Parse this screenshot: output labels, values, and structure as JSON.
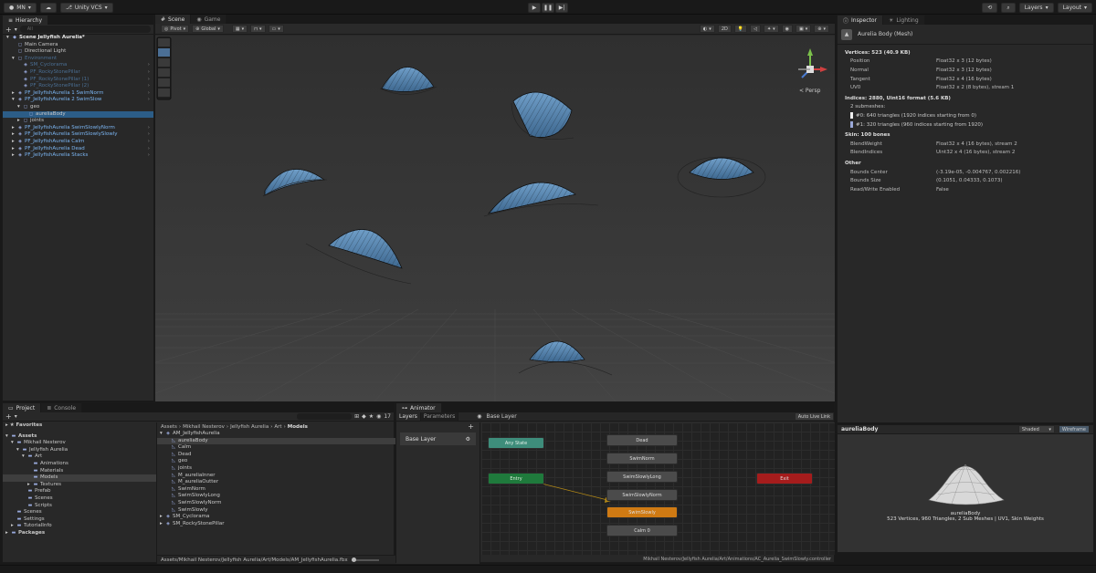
{
  "topbar": {
    "account": "MN",
    "vcs": "Unity VCS",
    "layers": "Layers",
    "layout": "Layout"
  },
  "hierarchy": {
    "tab": "Hierarchy",
    "search_placeholder": "All",
    "items": [
      {
        "label": "Scene Jellyfish Aurelia*",
        "level": 0,
        "style": "scene",
        "arrow": "▾",
        "icon": "unity-scene-icon"
      },
      {
        "label": "Main Camera",
        "level": 1,
        "style": "normal",
        "arrow": "",
        "icon": "gameobject-icon"
      },
      {
        "label": "Directional Light",
        "level": 1,
        "style": "normal",
        "arrow": "",
        "icon": "gameobject-icon"
      },
      {
        "label": "Environment",
        "level": 1,
        "style": "disabled",
        "arrow": "▾",
        "icon": "gameobject-icon"
      },
      {
        "label": "SM_Cyclorama",
        "level": 2,
        "style": "disabled",
        "arrow": "",
        "icon": "prefab-icon"
      },
      {
        "label": "PF_RockyStonePillar",
        "level": 2,
        "style": "disabled",
        "arrow": "",
        "icon": "prefab-icon"
      },
      {
        "label": "PF_RockyStonePillar (1)",
        "level": 2,
        "style": "disabled",
        "arrow": "",
        "icon": "prefab-icon"
      },
      {
        "label": "PF_RockyStonePillar (2)",
        "level": 2,
        "style": "disabled",
        "arrow": "",
        "icon": "prefab-icon"
      },
      {
        "label": "PF_JellyfishAurelia 1 SwimNorm",
        "level": 1,
        "style": "prefab",
        "arrow": "▸",
        "icon": "prefab-icon"
      },
      {
        "label": "PF_JellyfishAurelia 2 SwimSlow",
        "level": 1,
        "style": "prefab",
        "arrow": "▾",
        "icon": "prefab-icon"
      },
      {
        "label": "geo",
        "level": 2,
        "style": "normal",
        "arrow": "▾",
        "icon": "gameobject-icon"
      },
      {
        "label": "aureliaBody",
        "level": 3,
        "style": "normal",
        "arrow": "",
        "icon": "gameobject-icon"
      },
      {
        "label": "joints",
        "level": 2,
        "style": "normal",
        "arrow": "▸",
        "icon": "gameobject-icon"
      },
      {
        "label": "PF_JellyfishAurelia SwimSlowlyNorm",
        "level": 1,
        "style": "prefab",
        "arrow": "▸",
        "icon": "prefab-icon"
      },
      {
        "label": "PF_JellyfishAurelia SwimSlowlySlowly",
        "level": 1,
        "style": "prefab",
        "arrow": "▸",
        "icon": "prefab-icon"
      },
      {
        "label": "PF_JellyfishAurelia Calm",
        "level": 1,
        "style": "prefab",
        "arrow": "▸",
        "icon": "prefab-icon"
      },
      {
        "label": "PF_JellyfishAurelia Dead",
        "level": 1,
        "style": "prefab",
        "arrow": "▸",
        "icon": "prefab-icon"
      },
      {
        "label": "PF_JellyfishAurelia Stacks",
        "level": 1,
        "style": "prefab",
        "arrow": "▸",
        "icon": "prefab-icon"
      }
    ]
  },
  "scene": {
    "tabs": [
      "Scene",
      "Game"
    ],
    "pivot": "Pivot",
    "global": "Global",
    "mode_2d": "2D",
    "persp": "< Persp"
  },
  "inspector": {
    "tabs": [
      "Inspector",
      "Lighting"
    ],
    "title": "Aurelia Body (Mesh)",
    "vertices_header": "Vertices: 523 (40.9 KB)",
    "vertices": [
      {
        "k": "Position",
        "v": "Float32 x 3 (12 bytes)"
      },
      {
        "k": "Normal",
        "v": "Float32 x 3 (12 bytes)"
      },
      {
        "k": "Tangent",
        "v": "Float32 x 4 (16 bytes)"
      },
      {
        "k": "UV0",
        "v": "Float32 x 2 (8 bytes), stream 1"
      }
    ],
    "indices_header": "Indices: 2880, Uint16 format (5.6 KB)",
    "submeshes_label": "2 submeshes:",
    "submeshes": [
      "#0: 640 triangles (1920 indices starting from 0)",
      "#1: 320 triangles (960 indices starting from 1920)"
    ],
    "skin_header": "Skin: 100 bones",
    "skin": [
      {
        "k": "BlendWeight",
        "v": "Float32 x 4 (16 bytes), stream 2"
      },
      {
        "k": "BlendIndices",
        "v": "Uint32 x 4 (16 bytes), stream 2"
      }
    ],
    "other_header": "Other",
    "other": [
      {
        "k": "Bounds Center",
        "v": "(-3.19e-05, -0.004767, 0.002216)"
      },
      {
        "k": "Bounds Size",
        "v": "(0.1051, 0.04333, 0.1073)"
      },
      {
        "k": "Read/Write Enabled",
        "v": "False"
      }
    ]
  },
  "preview": {
    "name": "aureliaBody",
    "shaded": "Shaded",
    "wireframe": "Wireframe",
    "caption_name": "aureliaBody",
    "caption_info": "523 Vertices, 960 Triangles, 2 Sub Meshes | UV1, Skin Weights"
  },
  "project": {
    "tabs": [
      "Project",
      "Console"
    ],
    "count": "17",
    "favorites": "Favorites",
    "tree": [
      {
        "label": "Assets",
        "level": 0,
        "arrow": "▾",
        "bold": true,
        "sel": false
      },
      {
        "label": "Mikhail Nesterov",
        "level": 1,
        "arrow": "▾",
        "bold": false,
        "sel": false
      },
      {
        "label": "Jellyfish Aurelia",
        "level": 2,
        "arrow": "▾",
        "bold": false,
        "sel": false
      },
      {
        "label": "Art",
        "level": 3,
        "arrow": "▾",
        "bold": false,
        "sel": false
      },
      {
        "label": "Animations",
        "level": 4,
        "arrow": "",
        "bold": false,
        "sel": false
      },
      {
        "label": "Materials",
        "level": 4,
        "arrow": "",
        "bold": false,
        "sel": false
      },
      {
        "label": "Models",
        "level": 4,
        "arrow": "",
        "bold": false,
        "sel": true
      },
      {
        "label": "Textures",
        "level": 4,
        "arrow": "▸",
        "bold": false,
        "sel": false
      },
      {
        "label": "Prefab",
        "level": 3,
        "arrow": "",
        "bold": false,
        "sel": false
      },
      {
        "label": "Scenes",
        "level": 3,
        "arrow": "",
        "bold": false,
        "sel": false
      },
      {
        "label": "Scripts",
        "level": 3,
        "arrow": "",
        "bold": false,
        "sel": false
      },
      {
        "label": "Scenes",
        "level": 1,
        "arrow": "",
        "bold": false,
        "sel": false
      },
      {
        "label": "Settings",
        "level": 1,
        "arrow": "",
        "bold": false,
        "sel": false
      },
      {
        "label": "TutorialInfo",
        "level": 1,
        "arrow": "▸",
        "bold": false,
        "sel": false
      },
      {
        "label": "Packages",
        "level": 0,
        "arrow": "▸",
        "bold": true,
        "sel": false
      }
    ],
    "breadcrumb": [
      "Assets",
      "Mikhail Nesterov",
      "Jellyfish Aurelia",
      "Art",
      "Models"
    ],
    "files": [
      {
        "label": "AM_JellyfishAurelia",
        "level": 0,
        "arrow": "▾",
        "sel": false
      },
      {
        "label": "aureliaBody",
        "level": 1,
        "arrow": "",
        "sel": true
      },
      {
        "label": "Calm",
        "level": 1,
        "arrow": "",
        "sel": false
      },
      {
        "label": "Dead",
        "level": 1,
        "arrow": "",
        "sel": false
      },
      {
        "label": "geo",
        "level": 1,
        "arrow": "",
        "sel": false
      },
      {
        "label": "joints",
        "level": 1,
        "arrow": "",
        "sel": false
      },
      {
        "label": "M_aureliaInner",
        "level": 1,
        "arrow": "",
        "sel": false
      },
      {
        "label": "M_aureliaOutter",
        "level": 1,
        "arrow": "",
        "sel": false
      },
      {
        "label": "SwimNorm",
        "level": 1,
        "arrow": "",
        "sel": false
      },
      {
        "label": "SwimSlowlyLong",
        "level": 1,
        "arrow": "",
        "sel": false
      },
      {
        "label": "SwimSlowlyNorm",
        "level": 1,
        "arrow": "",
        "sel": false
      },
      {
        "label": "SwimSlowly",
        "level": 1,
        "arrow": "",
        "sel": false
      },
      {
        "label": "SM_Cyclorama",
        "level": 0,
        "arrow": "▸",
        "sel": false
      },
      {
        "label": "SM_RockyStonePillar",
        "level": 0,
        "arrow": "▸",
        "sel": false
      }
    ],
    "path": "Assets/Mikhail Nesterov/Jellyfish Aurelia/Art/Models/AM_JellyfishAurelia.fbx"
  },
  "animator": {
    "tab": "Animator",
    "layers_tab": "Layers",
    "params_tab": "Parameters",
    "breadcrumb": "Base Layer",
    "auto_live": "Auto Live Link",
    "layer": "Base Layer",
    "nodes": {
      "any": "Any State",
      "entry": "Entry",
      "exit": "Exit",
      "dead": "Dead",
      "swimnorm": "SwimNorm",
      "longn": "SwimSlowlyLong",
      "norm2": "SwimSlowlyNorm",
      "slow": "SwimSlowly",
      "calm": "Calm 0"
    },
    "path": "Mikhail Nesterov/Jellyfish Aurelia/Art/Animations/AC_Aurelia_SwimSlowly.controller"
  },
  "colors": {
    "accent": "#2c5d87",
    "prefab": "#7bb5f2",
    "entry": "#1f7a3c",
    "exit": "#a51c1c",
    "anystate": "#3e8d7b",
    "default_state": "#cf7a13"
  }
}
